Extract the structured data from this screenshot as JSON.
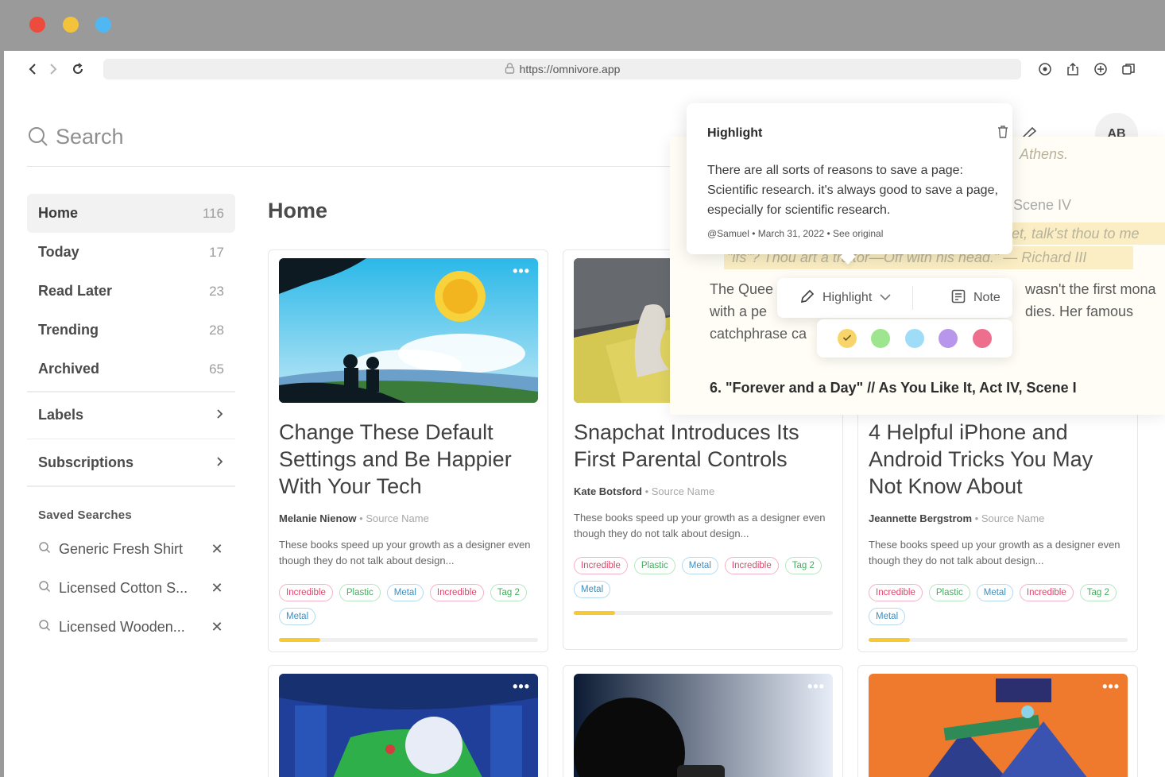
{
  "browser": {
    "url": "https://omnivore.app"
  },
  "search": {
    "placeholder": "Search"
  },
  "user": {
    "initials": "AB"
  },
  "sidebar": {
    "items": [
      {
        "label": "Home",
        "count": "116"
      },
      {
        "label": "Today",
        "count": "17"
      },
      {
        "label": "Read Later",
        "count": "23"
      },
      {
        "label": "Trending",
        "count": "28"
      },
      {
        "label": "Archived",
        "count": "65"
      }
    ],
    "labels": "Labels",
    "subscriptions": "Subscriptions",
    "saved_title": "Saved Searches",
    "saved": [
      {
        "label": "Generic Fresh Shirt"
      },
      {
        "label": "Licensed Cotton S..."
      },
      {
        "label": "Licensed Wooden..."
      }
    ]
  },
  "main": {
    "title": "Home",
    "more_label": "•••",
    "cards": [
      {
        "title": "Change These Default Settings and Be Happier With Your Tech",
        "author": "Melanie Nienow",
        "source": "Source Name",
        "desc": "These books speed up your growth as a designer even though they do not talk about design...",
        "tags": [
          {
            "label": "Incredible",
            "color": "red"
          },
          {
            "label": "Plastic",
            "color": "green"
          },
          {
            "label": "Metal",
            "color": "blue"
          },
          {
            "label": "Incredible",
            "color": "red"
          },
          {
            "label": "Tag 2",
            "color": "green"
          },
          {
            "label": "Metal",
            "color": "blue"
          }
        ],
        "progress": 0.16
      },
      {
        "title": "Snapchat Introduces Its First Parental Controls",
        "author": "Kate Botsford",
        "source": "Source Name",
        "desc": "These books speed up your growth as a designer even though they do not talk about design...",
        "tags": [
          {
            "label": "Incredible",
            "color": "red"
          },
          {
            "label": "Plastic",
            "color": "green"
          },
          {
            "label": "Metal",
            "color": "blue"
          },
          {
            "label": "Incredible",
            "color": "red"
          },
          {
            "label": "Tag 2",
            "color": "green"
          },
          {
            "label": "Metal",
            "color": "blue"
          }
        ],
        "progress": 0.16
      },
      {
        "title": "4 Helpful iPhone and Android Tricks You May Not Know About",
        "author": "Jeannette Bergstrom",
        "source": "Source Name",
        "desc": "These books speed up your growth as a designer even though they do not talk about design...",
        "tags": [
          {
            "label": "Incredible",
            "color": "red"
          },
          {
            "label": "Plastic",
            "color": "green"
          },
          {
            "label": "Metal",
            "color": "blue"
          },
          {
            "label": "Incredible",
            "color": "red"
          },
          {
            "label": "Tag 2",
            "color": "green"
          },
          {
            "label": "Metal",
            "color": "blue"
          }
        ],
        "progress": 0.16
      }
    ]
  },
  "reader": {
    "line_athens": "Athens.",
    "line_scene": "Scene IV",
    "quote_1": "pet, talk'st thou to me",
    "quote_2": "\"ifs\"? Thou art a traitor—Off with his head.\" — Richard III",
    "body_1a": "The Quee",
    "body_1b": "wasn't the first mona",
    "body_2a": "with a pe",
    "body_2b": "dies. Her famous",
    "body_3a": "catchphrase ca",
    "heading": "6. \"Forever and a Day\" // As You Like It, Act IV, Scene I"
  },
  "popover": {
    "title": "Highlight",
    "body": "There are all sorts of reasons to save a page: Scientific research. it's always good to save a page, especially for scientific research.",
    "meta": "@Samuel • March 31, 2022 • See original"
  },
  "highlight_toolbar": {
    "highlight_label": "Highlight",
    "note_label": "Note"
  },
  "colors": {
    "swatches": [
      "#f8d56b",
      "#9ee58f",
      "#9fdcf7",
      "#b896ec",
      "#ee6f8d"
    ],
    "selected_index": 0,
    "accent": "#f6c935"
  }
}
